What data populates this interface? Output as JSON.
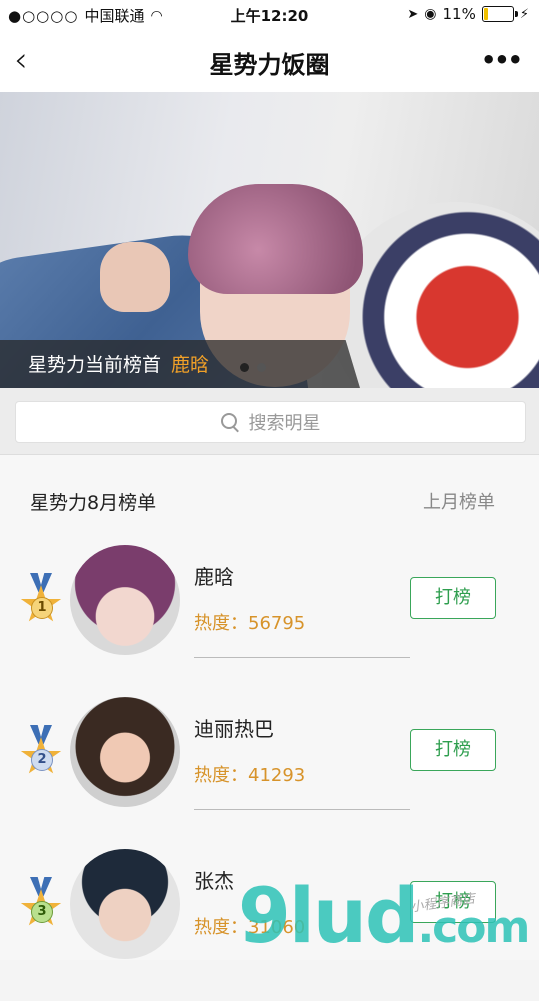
{
  "status_bar": {
    "signal": "●○○○○",
    "carrier": "中国联通",
    "wifi": "📶",
    "time": "上午12:20",
    "location_icon": "➤",
    "alarm_icon": "⏰",
    "battery_percent": "11%",
    "charging_icon": "⚡"
  },
  "nav": {
    "back": "‹",
    "title": "星势力饭圈",
    "more": "•••"
  },
  "banner": {
    "caption_prefix": "星势力当前榜首",
    "caption_name": "鹿晗",
    "page_count": 3,
    "active_page": 1
  },
  "search": {
    "placeholder": "搜索明星"
  },
  "list": {
    "title": "星势力8月榜单",
    "last_month_link": "上月榜单",
    "heat_label": "热度：",
    "vote_label": "打榜",
    "items": [
      {
        "rank": "1",
        "name": "鹿晗",
        "heat": "56795"
      },
      {
        "rank": "2",
        "name": "迪丽热巴",
        "heat": "41293"
      },
      {
        "rank": "3",
        "name": "张杰",
        "heat": "31060"
      }
    ]
  },
  "watermark": {
    "main": "9lud",
    "domain": ".com",
    "sub": "小程序商店"
  },
  "colors": {
    "accent_green": "#2e9e4e",
    "heat_orange": "#d7932a",
    "caption_highlight": "#f0a028"
  }
}
